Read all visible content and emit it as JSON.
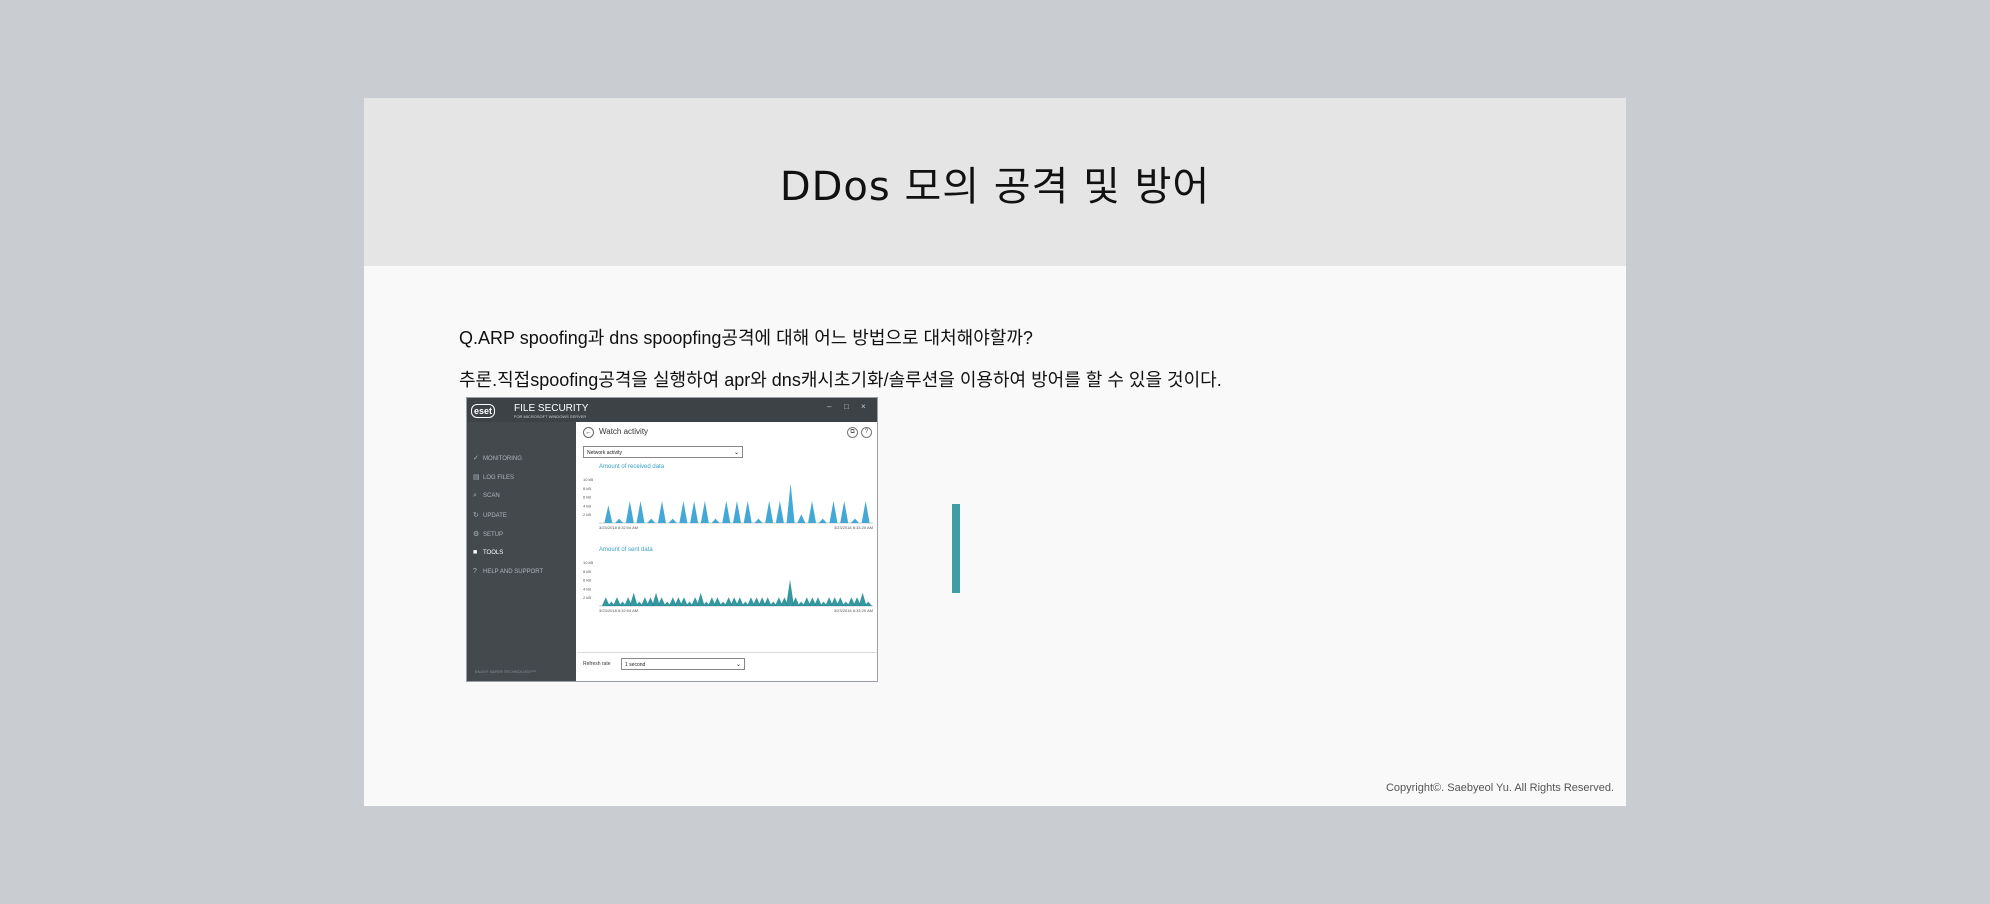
{
  "slide": {
    "title": "DDos 모의 공격 및 방어",
    "question": "Q.ARP spoofing과 dns spoopfing공격에 대해 어느 방법으로 대처해야할까?",
    "answer": "추론.직접spoofing공격을 실행하여 apr와 dns캐시초기화/솔루션을 이용하여 방어를 할 수 있을 것이다.",
    "copyright": "Copyright©. Saebyeol Yu. All Rights Reserved."
  },
  "screenshot": {
    "logo": "eset",
    "app_name": "FILE SECURITY",
    "app_subtitle": "FOR MICROSOFT WINDOWS SERVER",
    "window_controls": [
      "–",
      "□",
      "×"
    ],
    "nav": [
      {
        "label": "MONITORING",
        "icon": "check-icon",
        "active": false
      },
      {
        "label": "LOG FILES",
        "icon": "log-icon",
        "active": false
      },
      {
        "label": "SCAN",
        "icon": "search-icon",
        "active": false
      },
      {
        "label": "UPDATE",
        "icon": "refresh-icon",
        "active": false
      },
      {
        "label": "SETUP",
        "icon": "gear-icon",
        "active": false
      },
      {
        "label": "TOOLS",
        "icon": "toolbox-icon",
        "active": true
      },
      {
        "label": "HELP AND SUPPORT",
        "icon": "help-icon",
        "active": false
      }
    ],
    "sidebar_footer": "ENJOY SAFER TECHNOLOGY™",
    "page_title": "Watch activity",
    "activity_select": "Network activity",
    "refresh_label": "Refresh rate",
    "refresh_select": "1 second",
    "colors": {
      "received": "#2f9fd1",
      "sent": "#1f8c95",
      "sidebar": "#44494e"
    }
  },
  "chart_data": [
    {
      "type": "area",
      "title": "Amount of received data",
      "y_ticks": [
        "10 kB",
        "8 kB",
        "6 kB",
        "4 kB",
        "2 kB"
      ],
      "ylim": [
        0,
        10
      ],
      "x_start": "3/23/2018 8:32:04 AM",
      "x_end": "3/23/2018 8:33:20 AM",
      "peaks": [
        4,
        1,
        5,
        5,
        1,
        5,
        1,
        5,
        5,
        5,
        1,
        5,
        5,
        5,
        1,
        5,
        5,
        9,
        2,
        5,
        1,
        5,
        5,
        1,
        5
      ]
    },
    {
      "type": "area",
      "title": "Amount of sent data",
      "y_ticks": [
        "10 kB",
        "8 kB",
        "6 kB",
        "4 kB",
        "2 kB"
      ],
      "ylim": [
        0,
        10
      ],
      "x_start": "3/23/2018 8:32:04 AM",
      "x_end": "3/23/2018 8:33:20 AM",
      "peaks": [
        2,
        1,
        2,
        1,
        2,
        3,
        1,
        2,
        2,
        3,
        2,
        1,
        2,
        2,
        2,
        1,
        2,
        3,
        1,
        2,
        2,
        1,
        2,
        2,
        2,
        1,
        2,
        2,
        2,
        2,
        1,
        2,
        2,
        6,
        2,
        1,
        2,
        2,
        2,
        1,
        2,
        2,
        2,
        1,
        2,
        2,
        3,
        1
      ]
    }
  ]
}
